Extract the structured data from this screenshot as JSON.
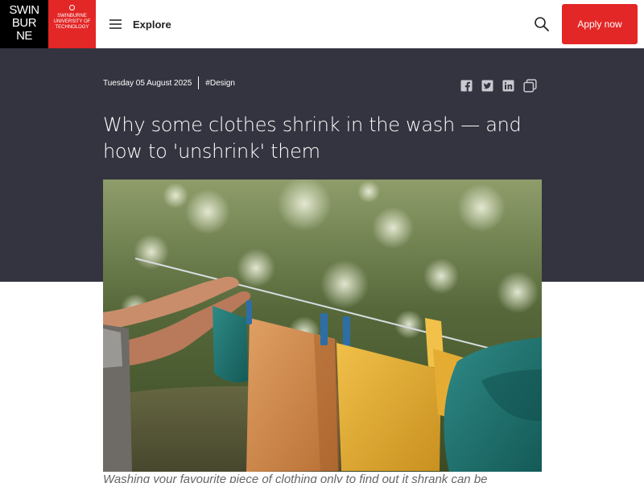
{
  "header": {
    "logo": {
      "wordmark": [
        "SWIN",
        "BUR",
        "NE"
      ],
      "name_lines": [
        "Swinburne",
        "University of",
        "Technology"
      ]
    },
    "explore_label": "Explore",
    "search_icon": "search-icon",
    "apply_label": "Apply now",
    "accent_color": "#e32726"
  },
  "article": {
    "date": "Tuesday 05 August 2025",
    "tag": "#Design",
    "share_icons": [
      "facebook-icon",
      "twitter-icon",
      "linkedin-icon",
      "copy-link-icon"
    ],
    "title": "Why some clothes shrink in the wash — and how to 'unshrink' them",
    "hero_background": "#33343f",
    "image_subject": "clothes hanging on a washing line outdoors",
    "caption_visible": "Washing your favourite piece of clothing only to find out it shrank can be"
  }
}
